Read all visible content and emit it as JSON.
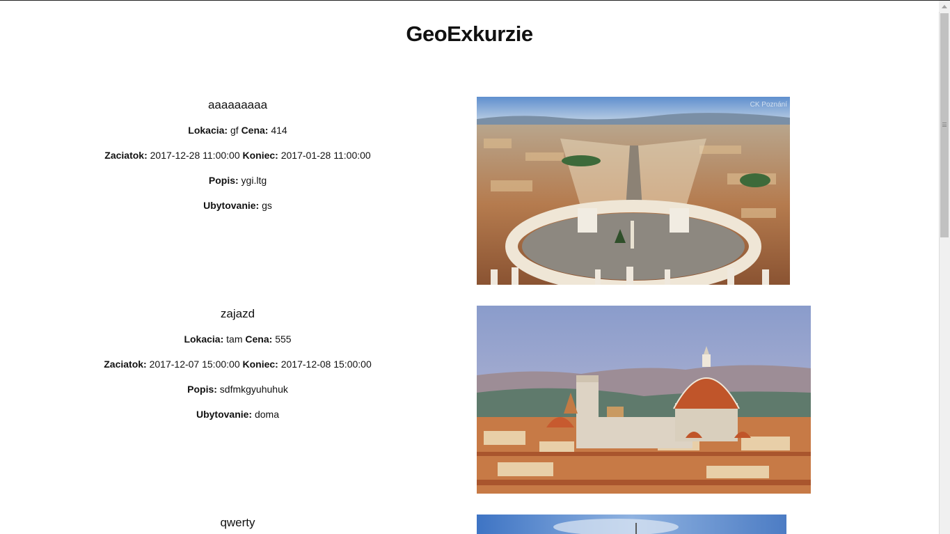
{
  "page": {
    "title": "GeoExkurzie"
  },
  "labels": {
    "location": "Lokacia:",
    "price": "Cena:",
    "start": "Zaciatok:",
    "end": "Koniec:",
    "description": "Popis:",
    "accommodation": "Ubytovanie:"
  },
  "trips": [
    {
      "name": "aaaaaaaaa",
      "location": "gf",
      "price": "414",
      "start": "2017-12-28 11:00:00",
      "end": "2017-01-28 11:00:00",
      "description": "ygi.ltg",
      "accommodation": "gs",
      "photo": "vatican-st-peters-square-photo"
    },
    {
      "name": "zajazd",
      "location": "tam",
      "price": "555",
      "start": "2017-12-07 15:00:00",
      "end": "2017-12-08 15:00:00",
      "description": "sdfmkgyuhuhuk",
      "accommodation": "doma",
      "photo": "florence-cathedral-photo"
    },
    {
      "name": "qwerty",
      "photo": "city-sky-photo"
    }
  ],
  "watermark": "CK Poznání",
  "colors": {
    "text": "#111111",
    "background": "#ffffff",
    "scrollbar_thumb": "#c1c1c1"
  }
}
